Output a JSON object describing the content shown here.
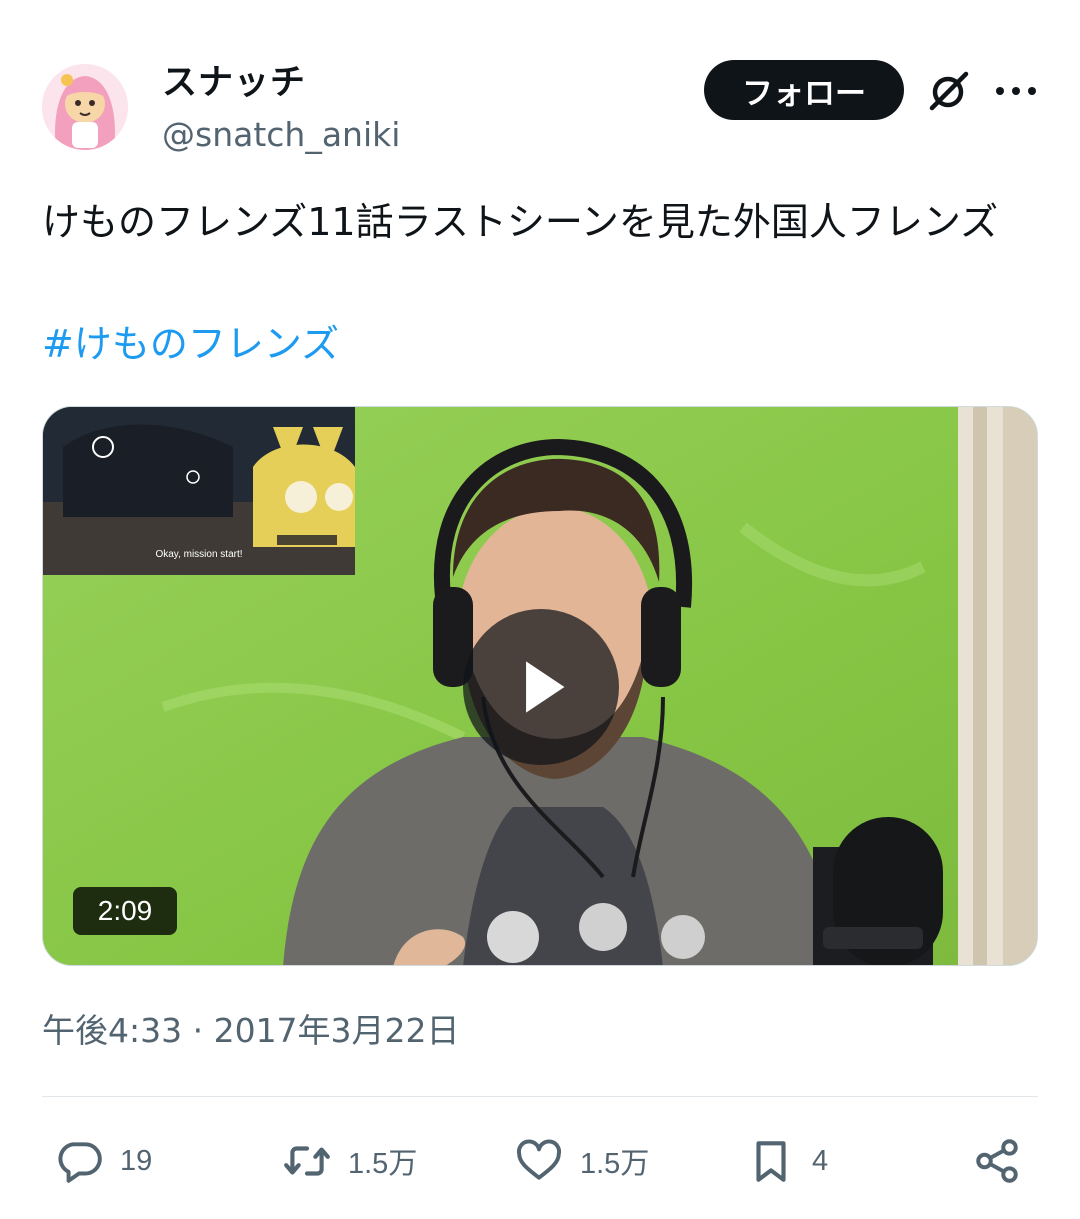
{
  "tweet": {
    "author": {
      "display_name": "スナッチ",
      "handle": "@snatch_aniki"
    },
    "follow_label": "フォロー",
    "text": "けものフレンズ11話ラストシーンを見た外国人フレンズ",
    "hashtag": "#けものフレンズ",
    "media": {
      "inset_subtitle": "Okay, mission start!",
      "duration": "2:09",
      "play_icon": "play-icon"
    },
    "timestamp": "午後4:33 · 2017年3月22日",
    "actions": {
      "reply_count": "19",
      "retweet_count": "1.5万",
      "like_count": "1.5万",
      "bookmark_count": "4"
    }
  },
  "colors": {
    "text": "#0f1419",
    "secondary": "#536471",
    "link": "#1d9bf0",
    "follow_bg": "#0f1419"
  }
}
